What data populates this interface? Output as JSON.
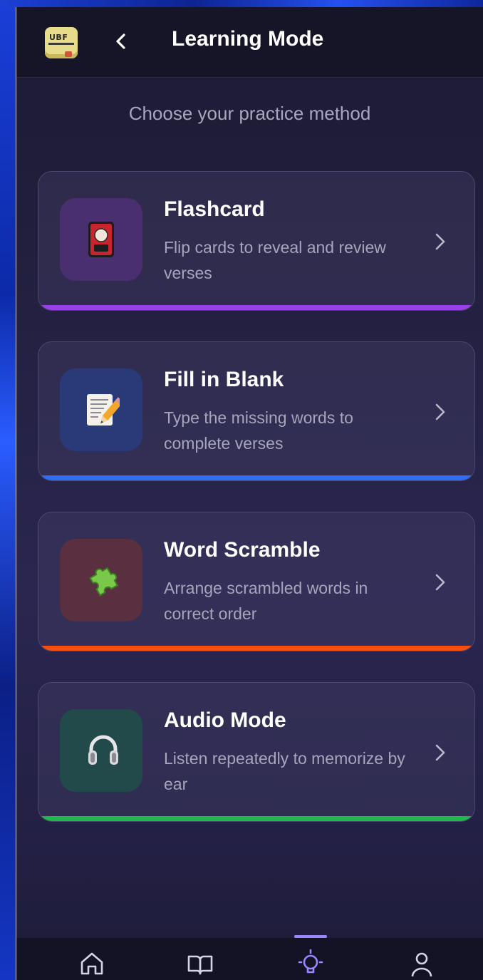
{
  "header": {
    "logo_text": "UBF",
    "title": "Learning Mode"
  },
  "subtitle": "Choose your practice method",
  "modes": [
    {
      "title": "Flashcard",
      "description": "Flip cards to reveal and review verses",
      "icon": "flashcard-icon",
      "accent": "#9b3fe8",
      "tile": "#4a2f70"
    },
    {
      "title": "Fill in Blank",
      "description": "Type the missing words to complete verses",
      "icon": "memo-pencil-icon",
      "accent": "#2f6ef2",
      "tile": "#2a3a78"
    },
    {
      "title": "Word Scramble",
      "description": "Arrange scrambled words in correct order",
      "icon": "puzzle-piece-icon",
      "accent": "#f5500f",
      "tile": "#5a2f3f"
    },
    {
      "title": "Audio Mode",
      "description": "Listen repeatedly to memorize by ear",
      "icon": "headphones-icon",
      "accent": "#1fb84b",
      "tile": "#234a4a"
    }
  ],
  "nav": {
    "items": [
      {
        "icon": "home-icon"
      },
      {
        "icon": "book-icon"
      },
      {
        "icon": "lightbulb-icon",
        "active": true
      },
      {
        "icon": "profile-icon"
      }
    ],
    "active_color": "#9a86ff"
  }
}
